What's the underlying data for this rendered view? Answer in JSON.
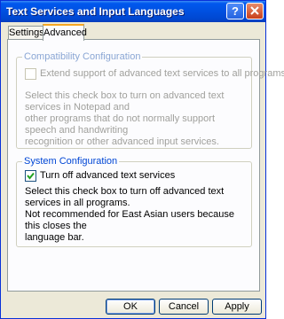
{
  "window": {
    "title": "Text Services and Input Languages",
    "help_label": "?",
    "close_label": "close"
  },
  "tabs": [
    {
      "label": "Settings",
      "selected": false
    },
    {
      "label": "Advanced",
      "selected": true
    }
  ],
  "compatibility": {
    "legend": "Compatibility Configuration",
    "checkbox_label": "Extend support of advanced text services to all programs",
    "checked": false,
    "enabled": false,
    "description": [
      "Select this check box to turn on advanced text services in Notepad and",
      "other programs that do not normally support speech and handwriting",
      "recognition or other advanced input services."
    ]
  },
  "system": {
    "legend": "System Configuration",
    "checkbox_label": "Turn off advanced text services",
    "checked": true,
    "enabled": true,
    "description": [
      "Select this check box to turn off advanced text services in all programs.",
      "Not recommended for East Asian users because this closes the",
      "language bar."
    ]
  },
  "buttons": {
    "ok": "OK",
    "cancel": "Cancel",
    "apply": "Apply"
  },
  "colors": {
    "titlebar": "#0054e3",
    "dialog_bg": "#ece9d8",
    "group_title": "#0046d5",
    "tab_highlight": "#f5a623"
  }
}
